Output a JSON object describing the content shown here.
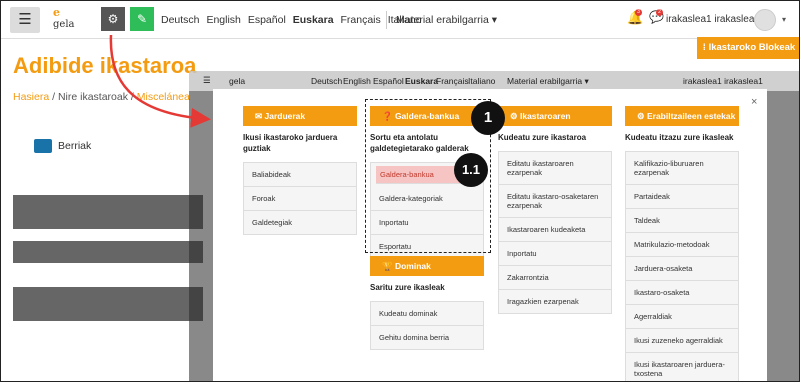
{
  "navbar": {
    "menu_icon": "☰",
    "logo": {
      "prefix": "e",
      "name": "gela"
    },
    "gear_icon": "⚙",
    "edit_icon": "✎",
    "languages": [
      "Deutsch",
      "English",
      "Español",
      "Euskara",
      "Français",
      "Italiano"
    ],
    "active_language": "Euskara",
    "material": "Material erabilgarria ▾",
    "notifications_count": "3",
    "messages_count": "2",
    "username": "irakaslea1 irakaslea1",
    "caret": "▾"
  },
  "blocks_button": "⁞ Ikastaroko Blokeak",
  "page": {
    "title": "Adibide ikastaroa",
    "breadcrumb": [
      "Hasiera",
      "/",
      "Nire ikastaroak",
      "/",
      "Miscelánea"
    ],
    "forum_label": "Berriak"
  },
  "modal": {
    "close": "×",
    "columns": [
      {
        "head": "✉ Jarduerak",
        "desc": "Ikusi ikastaroko jarduera guztiak",
        "items": [
          "Baliabideak",
          "Foroak",
          "Galdetegiak"
        ]
      },
      {
        "head": "❓ Galdera-bankua",
        "desc": "Sortu eta antolatu galdetegietarako galderak",
        "items": [
          "Galdera-bankua",
          "Galdera-kategoriak",
          "Inportatu",
          "Esportatu"
        ]
      },
      {
        "head": "⚙ Ikastaroaren ezarpenak",
        "desc": "Kudeatu zure ikastaroa",
        "items": [
          "Editatu ikastaroaren ezarpenak",
          "Editatu ikastaro-osaketaren ezarpenak",
          "Ikastaroaren kudeaketa",
          "Inportatu",
          "Zakarrontzia",
          "Iragazkien ezarpenak"
        ]
      },
      {
        "head": "⚙ Erabiltzaileen estekak",
        "desc": "Kudeatu itzazu zure ikasleak",
        "items": [
          "Kalifikazio-liburuaren ezarpenak",
          "Partaideak",
          "Taldeak",
          "Matrikulazio-metodoak",
          "Jarduera-osaketa",
          "Ikastaro-osaketa",
          "Agerraldiak",
          "Ikusi zuzeneko agerraldiak",
          "Ikusi ikastaroaren jarduera-txostena"
        ]
      },
      {
        "head": "🏆 Dominak",
        "desc": "Saritu zure ikasleak",
        "items": [
          "Kudeatu dominak",
          "Gehitu domina berria"
        ]
      }
    ]
  },
  "callouts": [
    "1",
    "1.1"
  ],
  "colors": {
    "accent": "#f39c12",
    "green": "#2ebd59",
    "arrow": "#e53935"
  }
}
